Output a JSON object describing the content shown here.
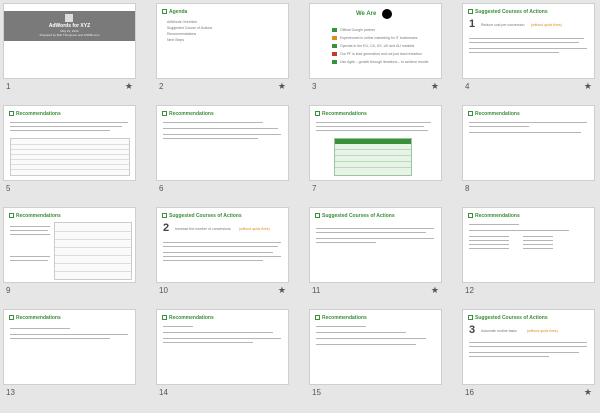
{
  "colors": {
    "accent": "#3a8f3a",
    "title_bg": "#7a7a7a",
    "highlight": "#e08a1e"
  },
  "slides": [
    {
      "num": "1",
      "star": "★",
      "title": "AdWords for XYZ",
      "date": "May 21, 2014",
      "byline": "Prepared by Bob Thompson and OSMIF.com"
    },
    {
      "num": "2",
      "star": "★",
      "title": "Agenda",
      "items": [
        "AdWords Overview",
        "Suggested Course of Actions",
        "Recommendations",
        "Next Steps"
      ]
    },
    {
      "num": "3",
      "star": "★",
      "title": "We Are",
      "items": [
        "Official Google partner",
        "Experienced in online marketing for IT businesses",
        "Operate in the EU, CA, US, UK and AU markets",
        "Our PF is lead generation and not just lead reduction",
        "Use Agile – growth through iterations – to achieve results"
      ]
    },
    {
      "num": "4",
      "star": "★",
      "title": "Suggested Courses of Actions",
      "big": "1",
      "subtitle": "Reduce cost per conversion",
      "subtitle_extra": "(without quick fixes)"
    },
    {
      "num": "5",
      "star": "",
      "title": "Recommendations"
    },
    {
      "num": "6",
      "star": "",
      "title": "Recommendations"
    },
    {
      "num": "7",
      "star": "",
      "title": "Recommendations"
    },
    {
      "num": "8",
      "star": "",
      "title": "Recommendations"
    },
    {
      "num": "9",
      "star": "",
      "title": "Recommendations"
    },
    {
      "num": "10",
      "star": "★",
      "title": "Suggested Courses of Actions",
      "big": "2",
      "subtitle": "Increase the number of conversions",
      "subtitle_extra": "(without quick fixes)"
    },
    {
      "num": "11",
      "star": "★",
      "title": "Suggested Courses of Actions"
    },
    {
      "num": "12",
      "star": "",
      "title": "Recommendations"
    },
    {
      "num": "13",
      "star": "",
      "title": "Recommendations"
    },
    {
      "num": "14",
      "star": "",
      "title": "Recommendations"
    },
    {
      "num": "15",
      "star": "",
      "title": "Recommendations"
    },
    {
      "num": "16",
      "star": "★",
      "title": "Suggested Courses of Actions",
      "big": "3",
      "subtitle": "Automate routine tasks",
      "subtitle_extra": "(without quick fixes)"
    }
  ]
}
